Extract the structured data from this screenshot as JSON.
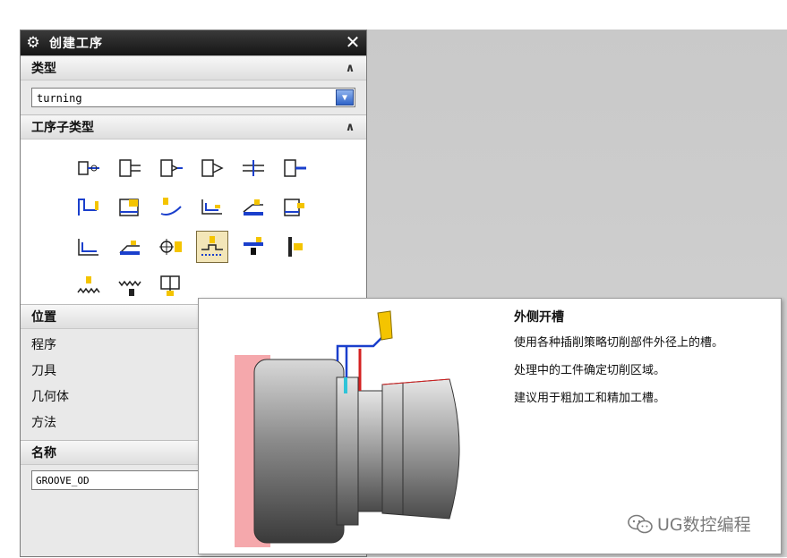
{
  "dialog": {
    "title": "创建工序",
    "icons": {
      "title": "gear-icon",
      "close": "close-icon"
    },
    "close_glyph": "✕",
    "type_section": {
      "label": "类型",
      "collapse_glyph": "∧",
      "selected_value": "turning"
    },
    "subtype_section": {
      "label": "工序子类型",
      "collapse_glyph": "∧"
    },
    "location_section": {
      "label": "位置",
      "items": [
        "程序",
        "刀具",
        "几何体",
        "方法"
      ]
    },
    "name_section": {
      "label": "名称",
      "value": "GROOVE_OD"
    }
  },
  "tooltip": {
    "title": "外侧开槽",
    "lines": [
      "使用各种插削策略切削部件外径上的槽。",
      "处理中的工件确定切削区域。",
      "建议用于粗加工和精加工槽。"
    ]
  },
  "watermark": {
    "text": "UG数控编程",
    "icon": "wechat-icon"
  },
  "colors": {
    "titlebar": "#151515",
    "accent_tool": "#f4c400",
    "toolpath": "#1a3fcc",
    "cut_line": "#d42020",
    "stock": "#f5a8ac"
  }
}
